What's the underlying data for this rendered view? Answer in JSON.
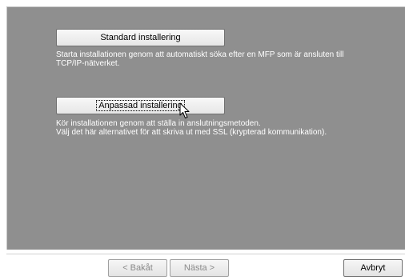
{
  "options": {
    "standard": {
      "label": "Standard installering",
      "description_lines": [
        "Starta installationen genom att automatiskt söka efter en MFP som är ansluten till",
        "TCP/IP-nätverket."
      ]
    },
    "custom": {
      "label": "Anpassad installering",
      "description_lines": [
        "Kör installationen genom att ställa in anslutningsmetoden.",
        "Välj det här alternativet för att skriva ut med SSL (krypterad kommunikation)."
      ]
    }
  },
  "navigation": {
    "back_label": "< Bakåt",
    "next_label": "Nästa >",
    "cancel_label": "Avbryt"
  },
  "icons": {
    "cursor": "mouse-pointer-icon"
  },
  "colors": {
    "panel_background": "#8f8f8f",
    "description_text": "#ffffff",
    "disabled_text": "#8a8a8a"
  }
}
